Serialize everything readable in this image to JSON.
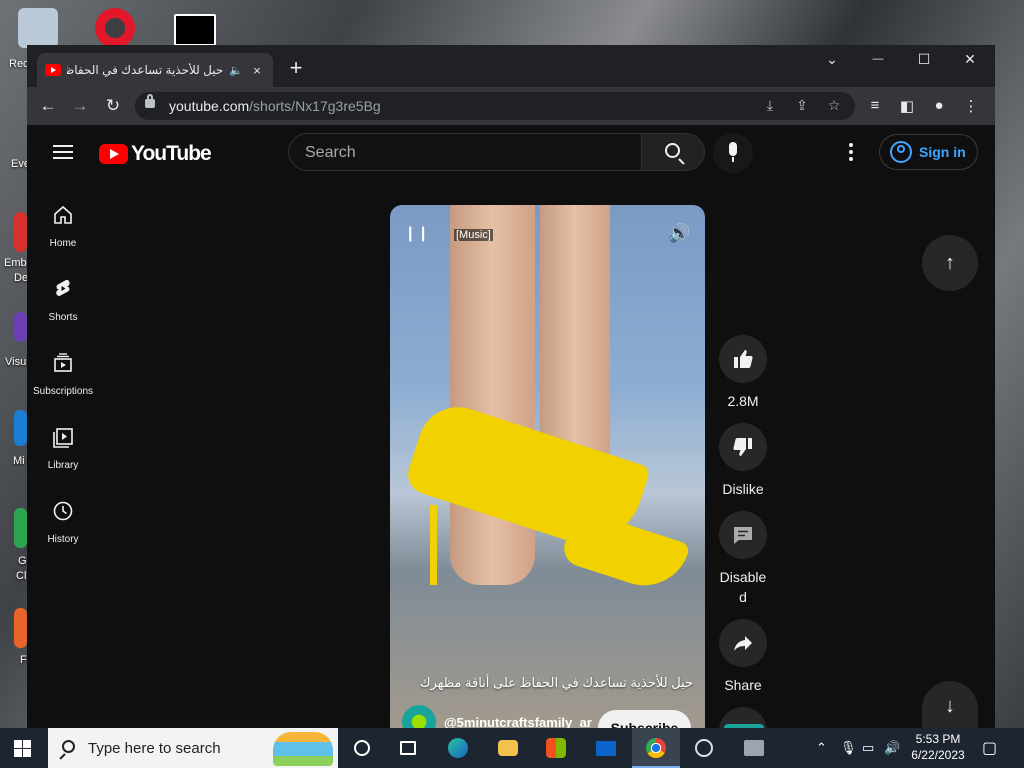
{
  "desktop": {
    "labels": [
      "Rec",
      "Eve",
      "Emb",
      "De",
      "Visu",
      "Mi",
      "G",
      "Cl",
      "F"
    ]
  },
  "browser": {
    "tab": {
      "title": "حيل للأحذية تساعدك في الحفاظ",
      "audio_icon": "speaker-icon",
      "close": "×"
    },
    "new_tab": "+",
    "window_controls": {
      "dropdown": "⌄",
      "minimize": "—",
      "maximize": "☐",
      "close": "✕"
    },
    "url_host": "youtube.com",
    "url_path": "/shorts/Nx17g3re5Bg"
  },
  "youtube": {
    "logo_text": "YouTube",
    "search_placeholder": "Search",
    "sign_in": "Sign in",
    "guide": [
      {
        "label": "Home",
        "icon": "home-icon"
      },
      {
        "label": "Shorts",
        "icon": "shorts-icon"
      },
      {
        "label": "Subscriptions",
        "icon": "subscriptions-icon"
      },
      {
        "label": "Library",
        "icon": "library-icon"
      },
      {
        "label": "History",
        "icon": "history-icon"
      }
    ],
    "short": {
      "caption_tag": "[Music]",
      "title": "حيل للأحذية تساعدك في الحفاظ على أناقة مظهرك",
      "channel": "@5minutcraftsfamily_ar",
      "subscribe": "Subscribe",
      "likes": "2.8M",
      "dislike": "Dislike",
      "comments_line1": "Disable",
      "comments_line2": "d",
      "share": "Share"
    }
  },
  "taskbar": {
    "search_placeholder": "Type here to search",
    "time": "5:53 PM",
    "date": "6/22/2023"
  }
}
